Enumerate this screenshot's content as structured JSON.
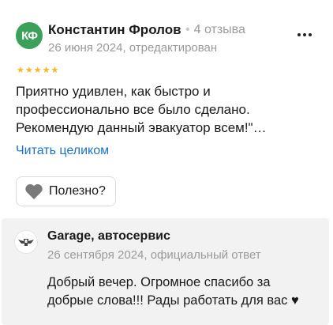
{
  "review": {
    "avatar_initials": "КФ",
    "avatar_color": "#3aa05a",
    "author_name": "Константин Фролов",
    "review_count": "4 отзыва",
    "date": "26 июня 2024, отредактирован",
    "rating": 5,
    "rating_max": 5,
    "star_color": "#fcb51a",
    "text_lines": [
      "Приятно удивлен, как быстро и",
      "профессионально все было сделано.",
      "Рекомендую данный эвакуатор всем!\"…"
    ],
    "read_more_label": "Читать целиком",
    "helpful_label": "Полезно?",
    "helpful_icon": "heart-icon",
    "more_icon": "more-dots-icon"
  },
  "reply": {
    "org_name": "Garage, автосервис",
    "meta": "26 сентября 2024, официальный ответ",
    "org_icon": "garage-logo-icon",
    "text_lines": [
      "Добрый вечер. Огромное спасибо за",
      "добрые слова!!! Рады работать для вас ♥"
    ]
  },
  "colors": {
    "link": "#1a73c8",
    "muted": "#9a9a9a",
    "reply_background": "#f2f2f2"
  }
}
